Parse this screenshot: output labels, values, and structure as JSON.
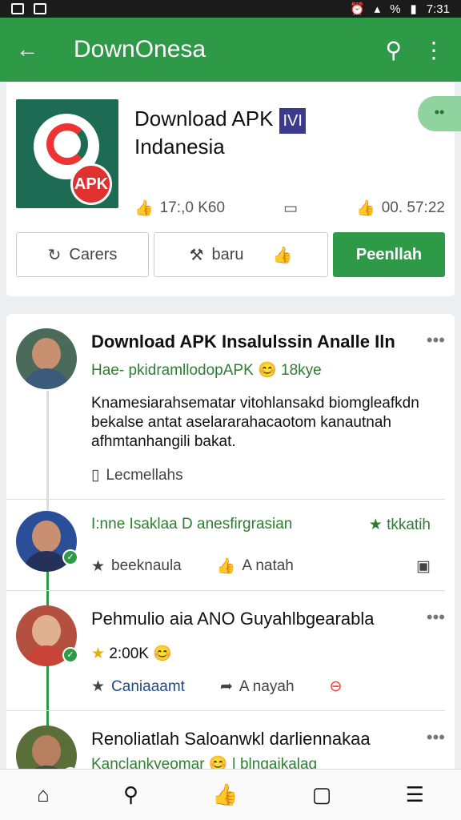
{
  "status_bar": {
    "time": "7:31",
    "battery": "%"
  },
  "app_bar": {
    "title": "DownOnesa",
    "back_icon": "arrow-left-icon",
    "search_icon": "search-icon",
    "menu_icon": "more-vert-icon"
  },
  "app": {
    "title_line1": "Download APK",
    "badge": "IVI",
    "title_line2": "Indanesia",
    "logo_text": "APK",
    "stat_likes": "17:,0 K60",
    "stat_right": "00. 57:22",
    "buttons": {
      "left": "Carers",
      "middle": "baru",
      "primary": "Peenllah"
    }
  },
  "posts": [
    {
      "title": "Download APK Insalulssin Analle Iln",
      "subtitle": "Hae- pkidramllodopAPK",
      "subtitle_tail": "18kye",
      "body": "Knamesiarahsematar vitohlansakd biomgleafkdn bekalse antat aselararahacaotom kanautnah afhmtanhangili bakat.",
      "meta_label": "Lecmellahs"
    },
    {
      "title": "",
      "subtitle": "I:nne Isaklaa D anesfirgrasian",
      "subtitle_tail": "tkkatih",
      "action1": "beeknaula",
      "action2": "A natah"
    },
    {
      "title": "Pehmulio aia ANO Guyahlbgearabla",
      "rating": "2:00K",
      "action1": "Caniaaamt",
      "action2": "A nayah"
    },
    {
      "title": "Renoliatlah Saloanwkl darliennakaa",
      "subtitle": "Kanclankyeomar",
      "subtitle_tail": "blngaikalag"
    }
  ],
  "bottom_nav": [
    "home-icon",
    "search-icon",
    "thumb-icon",
    "square-icon",
    "menu-icon"
  ]
}
